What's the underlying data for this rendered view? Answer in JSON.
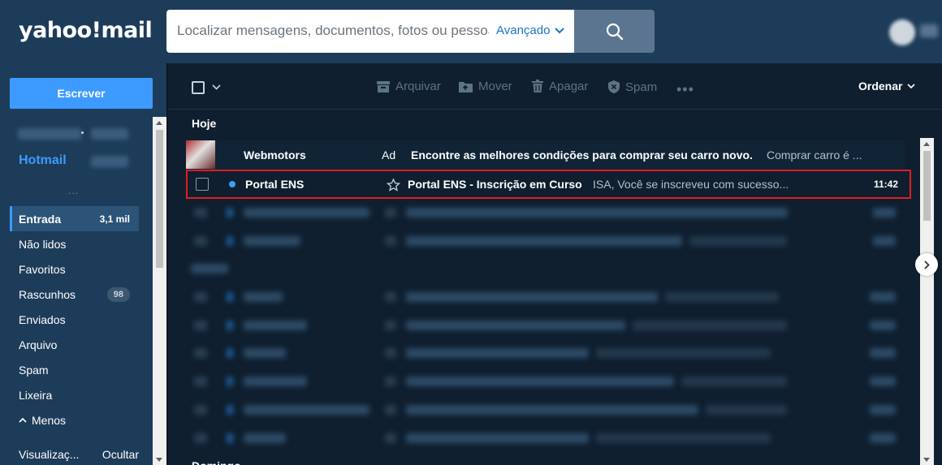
{
  "header": {
    "logo": "yahoo!mail",
    "search_placeholder": "Localizar mensagens, documentos, fotos ou pessoas",
    "advanced_label": "Avançado"
  },
  "sidebar": {
    "compose_label": "Escrever",
    "account_label": "Hotmail",
    "separator": "...",
    "folders": [
      {
        "label": "Entrada",
        "count": "3,1 mil"
      },
      {
        "label": "Não lidos",
        "count": ""
      },
      {
        "label": "Favoritos",
        "count": ""
      },
      {
        "label": "Rascunhos",
        "count": "98"
      },
      {
        "label": "Enviados",
        "count": ""
      },
      {
        "label": "Arquivo",
        "count": ""
      },
      {
        "label": "Spam",
        "count": ""
      },
      {
        "label": "Lixeira",
        "count": ""
      }
    ],
    "less_label": "Menos",
    "views_label": "Visualizaç...",
    "hide_label": "Ocultar"
  },
  "toolbar": {
    "archive_label": "Arquivar",
    "move_label": "Mover",
    "delete_label": "Apagar",
    "spam_label": "Spam",
    "more_label": "•••",
    "sort_label": "Ordenar"
  },
  "sections": {
    "today_label": "Hoje",
    "sunday_label": "Domingo"
  },
  "ad": {
    "sender": "Webmotors",
    "tag": "Ad",
    "subject": "Encontre as melhores condições para comprar seu carro novo.",
    "snippet": "Comprar carro é ..."
  },
  "selected_message": {
    "sender": "Portal ENS",
    "subject": "Portal ENS - Inscrição em Curso",
    "snippet": "ISA, Você se inscreveu com sucesso...",
    "time": "11:42"
  },
  "colors": {
    "accent": "#3d9bff",
    "header_bg": "#1d3c5a",
    "main_bg": "#0f1f2f",
    "highlight_border": "#e21c21"
  }
}
